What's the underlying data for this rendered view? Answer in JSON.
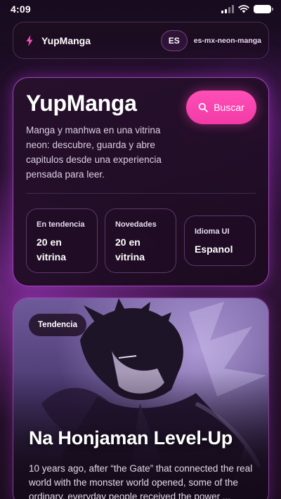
{
  "status_bar": {
    "time": "4:09",
    "icons": [
      "cellular-signal-icon",
      "wifi-icon",
      "battery-icon"
    ]
  },
  "app_bar": {
    "brand_icon": "lightning-bolt-icon",
    "brand_name": "YupManga",
    "language_code": "ES",
    "locale_id": "es-mx-neon-manga"
  },
  "hero": {
    "title": "YupManga",
    "description": "Manga y manhwa en una vitrina neon: descubre, guarda y abre capitulos desde una experiencia pensada para leer.",
    "search_button_label": "Buscar",
    "search_icon": "search-icon",
    "stats": [
      {
        "label": "En tendencia",
        "value": "20 en vitrina"
      },
      {
        "label": "Novedades",
        "value": "20 en vitrina"
      },
      {
        "label": "Idioma UI",
        "value": "Espanol"
      }
    ]
  },
  "featured": {
    "badge": "Tendencia",
    "title": "Na Honjaman Level-Up",
    "synopsis": "10 years ago, after “the Gate” that connected the real world with the monster world opened, some of the ordinary, everyday people received the power ..."
  },
  "colors": {
    "accent_pink": "#f23aa6",
    "neon_purple": "#c85ae6",
    "background": "#221028"
  }
}
